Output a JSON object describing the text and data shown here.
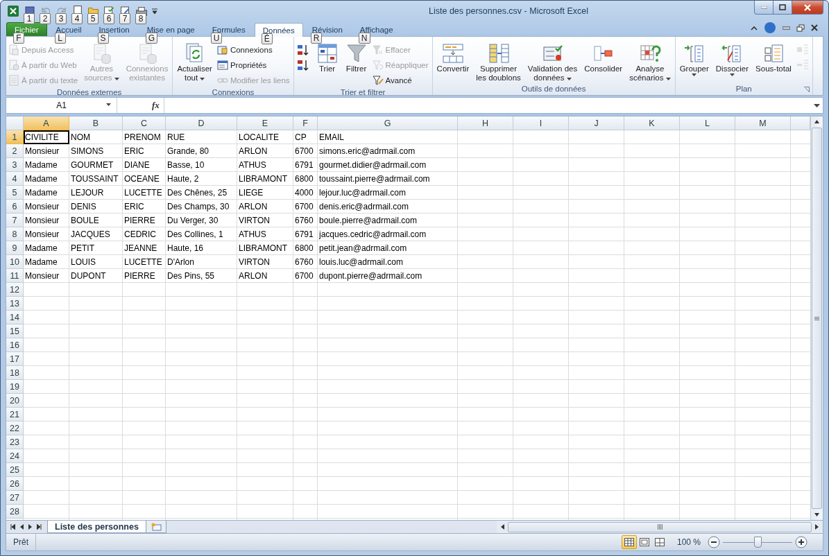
{
  "window": {
    "title": "Liste des personnes.csv  -  Microsoft Excel"
  },
  "quick_access": [
    {
      "keytip": "1",
      "disabled": false
    },
    {
      "keytip": "2",
      "disabled": true
    },
    {
      "keytip": "3",
      "disabled": true
    },
    {
      "keytip": "4",
      "disabled": false
    },
    {
      "keytip": "5",
      "disabled": false
    },
    {
      "keytip": "6",
      "disabled": false
    },
    {
      "keytip": "7",
      "disabled": false
    },
    {
      "keytip": "8",
      "disabled": false
    }
  ],
  "tabs": [
    {
      "label": "Fichier",
      "keytip": "F",
      "selected": false,
      "kind": "file"
    },
    {
      "label": "Accueil",
      "keytip": "L",
      "selected": false,
      "kind": "tab"
    },
    {
      "label": "Insertion",
      "keytip": "S",
      "selected": false,
      "kind": "tab"
    },
    {
      "label": "Mise en page",
      "keytip": "G",
      "selected": false,
      "kind": "tab"
    },
    {
      "label": "Formules",
      "keytip": "U",
      "selected": false,
      "kind": "tab"
    },
    {
      "label": "Données",
      "keytip": "É",
      "selected": true,
      "kind": "tab"
    },
    {
      "label": "Révision",
      "keytip": "R",
      "selected": false,
      "kind": "tab"
    },
    {
      "label": "Affichage",
      "keytip": "N",
      "selected": false,
      "kind": "tab"
    }
  ],
  "ribbon": [
    {
      "title": "Données externes",
      "columns": [
        {
          "kind": "stack",
          "items": [
            {
              "label": "Depuis Access",
              "disabled": true
            },
            {
              "label": "À partir du Web",
              "disabled": true
            },
            {
              "label": "À partir du texte",
              "disabled": true
            }
          ]
        },
        {
          "kind": "large",
          "lines": [
            "Autres",
            "sources"
          ],
          "dropdown": true,
          "disabled": true
        },
        {
          "kind": "large",
          "lines": [
            "Connexions",
            "existantes"
          ],
          "disabled": true
        }
      ]
    },
    {
      "title": "Connexions",
      "columns": [
        {
          "kind": "large",
          "lines": [
            "Actualiser",
            "tout"
          ],
          "dropdown": true,
          "disabled": false
        },
        {
          "kind": "stack",
          "items": [
            {
              "label": "Connexions",
              "disabled": false
            },
            {
              "label": "Propriétés",
              "disabled": false
            },
            {
              "label": "Modifier les liens",
              "disabled": true
            }
          ]
        }
      ]
    },
    {
      "title": "Trier et filtrer",
      "columns": [
        {
          "kind": "stack",
          "items": [
            {
              "disabled": false
            },
            {
              "disabled": false
            }
          ]
        },
        {
          "kind": "large",
          "lines": [
            "Trier"
          ],
          "disabled": false
        },
        {
          "kind": "large",
          "lines": [
            "Filtrer"
          ],
          "disabled": false
        },
        {
          "kind": "stack",
          "items": [
            {
              "label": "Effacer",
              "disabled": true
            },
            {
              "label": "Réappliquer",
              "disabled": true
            },
            {
              "label": "Avancé",
              "disabled": false
            }
          ]
        }
      ]
    },
    {
      "title": "Outils de données",
      "columns": [
        {
          "kind": "large",
          "lines": [
            "Convertir"
          ],
          "disabled": false
        },
        {
          "kind": "large",
          "lines": [
            "Supprimer",
            "les doublons"
          ],
          "disabled": false
        },
        {
          "kind": "large",
          "lines": [
            "Validation des",
            "données"
          ],
          "dropdown": true,
          "disabled": false
        },
        {
          "kind": "large",
          "lines": [
            "Consolider"
          ],
          "disabled": false
        },
        {
          "kind": "large",
          "lines": [
            "Analyse",
            "scénarios"
          ],
          "dropdown": true,
          "disabled": false
        }
      ]
    },
    {
      "title": "Plan",
      "launcher": true,
      "columns": [
        {
          "kind": "large",
          "lines": [
            "Grouper"
          ],
          "dropdown": true,
          "disabled": false
        },
        {
          "kind": "large",
          "lines": [
            "Dissocier"
          ],
          "dropdown": true,
          "disabled": false
        },
        {
          "kind": "large",
          "lines": [
            "Sous-total"
          ],
          "disabled": false
        },
        {
          "kind": "stack",
          "items": [
            {
              "disabled": true
            },
            {
              "disabled": true
            }
          ]
        }
      ]
    }
  ],
  "formula_bar": {
    "name_box": "A1",
    "fx": "fx"
  },
  "grid": {
    "columns": [
      {
        "label": "A",
        "selected": true
      },
      {
        "label": "B",
        "selected": false
      },
      {
        "label": "C",
        "selected": false
      },
      {
        "label": "D",
        "selected": false
      },
      {
        "label": "E",
        "selected": false
      },
      {
        "label": "F",
        "selected": false
      },
      {
        "label": "G",
        "selected": false
      },
      {
        "label": "H",
        "selected": false
      },
      {
        "label": "I",
        "selected": false
      },
      {
        "label": "J",
        "selected": false
      },
      {
        "label": "K",
        "selected": false
      },
      {
        "label": "L",
        "selected": false
      },
      {
        "label": "M",
        "selected": false
      }
    ],
    "rows": [
      {
        "number": "1",
        "selected": true,
        "cells": [
          "CIVILITE",
          "NOM",
          "PRENOM",
          "RUE",
          "LOCALITE",
          "CP",
          "EMAIL"
        ]
      },
      {
        "number": "2",
        "selected": false,
        "cells": [
          "Monsieur",
          "SIMONS",
          "ERIC",
          "Grande, 80",
          "ARLON",
          "6700",
          "simons.eric@adrmail.com"
        ]
      },
      {
        "number": "3",
        "selected": false,
        "cells": [
          "Madame",
          "GOURMET",
          "DIANE",
          "Basse, 10",
          "ATHUS",
          "6791",
          "gourmet.didier@adrmail.com"
        ]
      },
      {
        "number": "4",
        "selected": false,
        "cells": [
          "Madame",
          "TOUSSAINT",
          "OCEANE",
          "Haute, 2",
          "LIBRAMONT",
          "6800",
          "toussaint.pierre@adrmail.com"
        ]
      },
      {
        "number": "5",
        "selected": false,
        "cells": [
          "Madame",
          "LEJOUR",
          "LUCETTE",
          "Des Chênes, 25",
          "LIEGE",
          "4000",
          "lejour.luc@adrmail.com"
        ]
      },
      {
        "number": "6",
        "selected": false,
        "cells": [
          "Monsieur",
          "DENIS",
          "ERIC",
          "Des Champs, 30",
          "ARLON",
          "6700",
          "denis.eric@adrmail.com"
        ]
      },
      {
        "number": "7",
        "selected": false,
        "cells": [
          "Monsieur",
          "BOULE",
          "PIERRE",
          "Du Verger, 30",
          "VIRTON",
          "6760",
          "boule.pierre@adrmail.com"
        ]
      },
      {
        "number": "8",
        "selected": false,
        "cells": [
          "Monsieur",
          "JACQUES",
          "CEDRIC",
          "Des Collines, 1",
          "ATHUS",
          "6791",
          "jacques.cedric@adrmail.com"
        ]
      },
      {
        "number": "9",
        "selected": false,
        "cells": [
          "Madame",
          "PETIT",
          "JEANNE",
          "Haute, 16",
          "LIBRAMONT",
          "6800",
          "petit.jean@adrmail.com"
        ]
      },
      {
        "number": "10",
        "selected": false,
        "cells": [
          "Madame",
          "LOUIS",
          "LUCETTE",
          "D'Arlon",
          "VIRTON",
          "6760",
          "louis.luc@adrmail.com"
        ]
      },
      {
        "number": "11",
        "selected": false,
        "cells": [
          "Monsieur",
          "DUPONT",
          "PIERRE",
          "Des Pins, 55",
          "ARLON",
          "6700",
          "dupont.pierre@adrmail.com"
        ]
      },
      {
        "number": "12",
        "selected": false
      },
      {
        "number": "13",
        "selected": false
      },
      {
        "number": "14",
        "selected": false
      },
      {
        "number": "15",
        "selected": false
      },
      {
        "number": "16",
        "selected": false
      },
      {
        "number": "17",
        "selected": false
      },
      {
        "number": "18",
        "selected": false
      },
      {
        "number": "19",
        "selected": false
      },
      {
        "number": "20",
        "selected": false
      },
      {
        "number": "21",
        "selected": false
      },
      {
        "number": "22",
        "selected": false
      },
      {
        "number": "23",
        "selected": false
      },
      {
        "number": "24",
        "selected": false
      },
      {
        "number": "25",
        "selected": false
      },
      {
        "number": "26",
        "selected": false
      },
      {
        "number": "27",
        "selected": false
      },
      {
        "number": "28",
        "selected": false
      }
    ]
  },
  "sheet_tabs": [
    {
      "label": "Liste des personnes",
      "selected": true
    }
  ],
  "status_bar": {
    "text": "Prêt",
    "views": [
      {
        "selected": true
      },
      {
        "selected": false
      },
      {
        "selected": false
      }
    ],
    "zoom": "100 %",
    "zoom_level": {
      "level": 0.5
    }
  }
}
